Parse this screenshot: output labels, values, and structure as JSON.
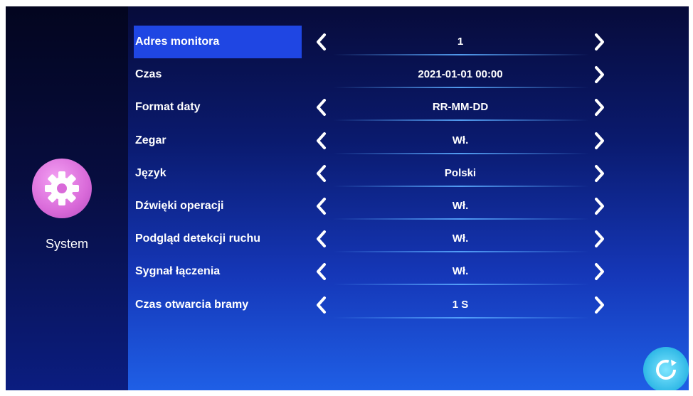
{
  "sidebar": {
    "section_label": "System",
    "icon": "gear-icon"
  },
  "colors": {
    "accent_selected": "#1f46e3",
    "gear_icon": "#d96ad9",
    "refresh_button": "#2fb8e6"
  },
  "settings": [
    {
      "label": "Adres monitora",
      "value": "1",
      "has_left_arrow": true,
      "selected": true
    },
    {
      "label": "Czas",
      "value": "2021-01-01  00:00",
      "has_left_arrow": false,
      "selected": false
    },
    {
      "label": "Format daty",
      "value": "RR-MM-DD",
      "has_left_arrow": true,
      "selected": false
    },
    {
      "label": "Zegar",
      "value": "Wł.",
      "has_left_arrow": true,
      "selected": false
    },
    {
      "label": "Język",
      "value": "Polski",
      "has_left_arrow": true,
      "selected": false
    },
    {
      "label": "Dźwięki operacji",
      "value": "Wł.",
      "has_left_arrow": true,
      "selected": false
    },
    {
      "label": "Podgląd detekcji ruchu",
      "value": "Wł.",
      "has_left_arrow": true,
      "selected": false
    },
    {
      "label": "Sygnał łączenia",
      "value": "Wł.",
      "has_left_arrow": true,
      "selected": false
    },
    {
      "label": "Czas otwarcia bramy",
      "value": "1 S",
      "has_left_arrow": true,
      "selected": false
    }
  ],
  "refresh_icon": "refresh-icon"
}
